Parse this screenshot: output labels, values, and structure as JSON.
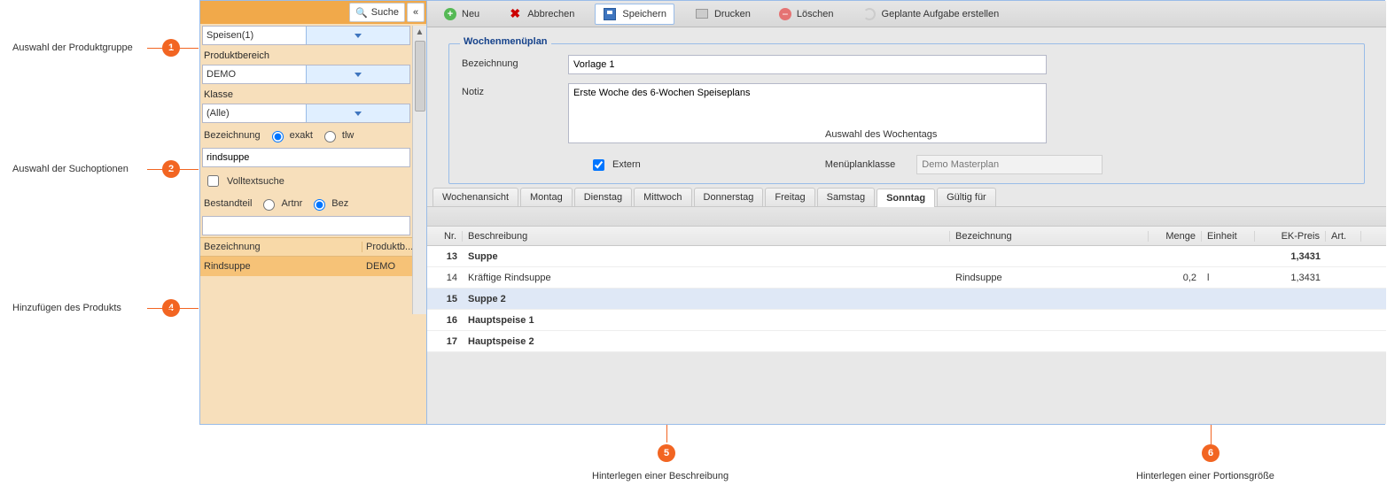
{
  "callouts": {
    "c1": "Auswahl der Produktgruppe",
    "c2": "Auswahl der Suchoptionen",
    "c4": "Hinzufügen des Produkts",
    "c5": "Hinterlegen einer Beschreibung",
    "c6": "Hinterlegen einer Portionsgröße"
  },
  "sidebar": {
    "search_btn": "Suche",
    "product_group_value": "Speisen(1)",
    "field_area_label": "Produktbereich",
    "field_area_value": "DEMO",
    "field_class_label": "Klasse",
    "field_class_value": "(Alle)",
    "field_name_label": "Bezeichnung",
    "radio_exact": "exakt",
    "radio_part": "tlw",
    "search_value": "rindsuppe",
    "fulltext_label": "Volltextsuche",
    "component_label": "Bestandteil",
    "radio_artnr": "Artnr",
    "radio_bez": "Bez",
    "result_col1": "Bezeichnung",
    "result_col2": "Produktb...",
    "result_r1_name": "Rindsuppe",
    "result_r1_area": "DEMO"
  },
  "toolbar": {
    "new": "Neu",
    "cancel": "Abbrechen",
    "save": "Speichern",
    "print": "Drucken",
    "delete": "Löschen",
    "schedule": "Geplante Aufgabe erstellen"
  },
  "form": {
    "legend": "Wochenmenüplan",
    "name_label": "Bezeichnung",
    "name_value": "Vorlage 1",
    "note_label": "Notiz",
    "note_value": "Erste Woche des 6-Wochen Speiseplans",
    "note_anno": "Auswahl des Wochentags",
    "extern_label": "Extern",
    "class_label": "Menüplanklasse",
    "class_value": "Demo Masterplan"
  },
  "tabs": {
    "weekview": "Wochenansicht",
    "mon": "Montag",
    "tue": "Dienstag",
    "wed": "Mittwoch",
    "thu": "Donnerstag",
    "fri": "Freitag",
    "sat": "Samstag",
    "sun": "Sonntag",
    "valid": "Gültig für"
  },
  "grid": {
    "h_nr": "Nr.",
    "h_desc": "Beschreibung",
    "h_bez": "Bezeichnung",
    "h_menge": "Menge",
    "h_einh": "Einheit",
    "h_ek": "EK-Preis",
    "h_art": "Art.",
    "rows": [
      {
        "nr": "13",
        "desc": "Suppe",
        "bez": "",
        "menge": "",
        "einh": "",
        "ek": "1,3431",
        "bold": true
      },
      {
        "nr": "14",
        "desc": "Kräftige Rindsuppe",
        "bez": "Rindsuppe",
        "menge": "0,2",
        "einh": "l",
        "ek": "1,3431",
        "bold": false
      },
      {
        "nr": "15",
        "desc": "Suppe 2",
        "bez": "",
        "menge": "",
        "einh": "",
        "ek": "",
        "bold": true,
        "selected": true
      },
      {
        "nr": "16",
        "desc": "Hauptspeise 1",
        "bez": "",
        "menge": "",
        "einh": "",
        "ek": "",
        "bold": true
      },
      {
        "nr": "17",
        "desc": "Hauptspeise 2",
        "bez": "",
        "menge": "",
        "einh": "",
        "ek": "",
        "bold": true
      }
    ]
  }
}
